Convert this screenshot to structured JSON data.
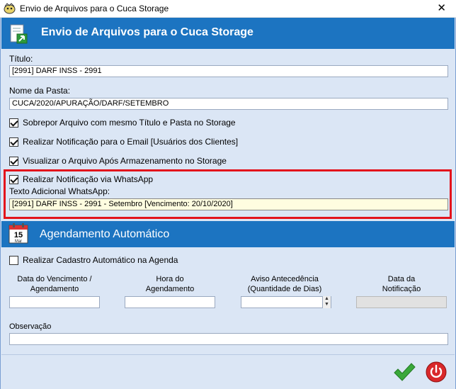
{
  "window": {
    "title": "Envio de Arquivos para o Cuca Storage",
    "close_glyph": "✕"
  },
  "header": {
    "title": "Envio de Arquivos para o Cuca Storage",
    "icon": "upload-document-icon"
  },
  "form": {
    "titulo_label": "Título:",
    "titulo_value": "[2991] DARF INSS - 2991",
    "pasta_label": "Nome da Pasta:",
    "pasta_value": "CUCA/2020/APURAÇÃO/DARF/SETEMBRO",
    "opt_sobrepor": "Sobrepor Arquivo com mesmo Título e Pasta no Storage",
    "opt_email": "Realizar Notificação para o Email [Usuários dos Clientes]",
    "opt_visualizar": "Visualizar o Arquivo Após Armazenamento no Storage",
    "opt_whatsapp": "Realizar Notificação via WhatsApp",
    "texto_label": "Texto Adicional WhatsApp:",
    "texto_value": "[2991] DARF INSS - 2991 - Setembro [Vencimento: 20/10/2020]"
  },
  "checkbox_states": {
    "sobrepor": true,
    "email": true,
    "visualizar": true,
    "whatsapp": true,
    "cadastro": false
  },
  "agendamento": {
    "title": "Agendamento Automático",
    "calendar_day": "15",
    "calendar_month": "Mar",
    "opt_cadastro": "Realizar Cadastro Automático na Agenda",
    "col1_line1": "Data do Vencimento /",
    "col1_line2": "Agendamento",
    "col2_line1": "Hora do",
    "col2_line2": "Agendamento",
    "col3_line1": "Aviso Antecedência",
    "col3_line2": "(Quantidade de Dias)",
    "col4_line1": "Data da",
    "col4_line2": "Notificação",
    "observacao_label": "Observação"
  },
  "colors": {
    "header_blue": "#1c74c1",
    "frame_bg": "#dbe6f5",
    "highlight_red": "#e3131c",
    "whatsapp_field_bg": "#fffde0"
  },
  "buttons": {
    "ok_icon": "green-checkmark-icon",
    "exit_icon": "power-icon"
  }
}
